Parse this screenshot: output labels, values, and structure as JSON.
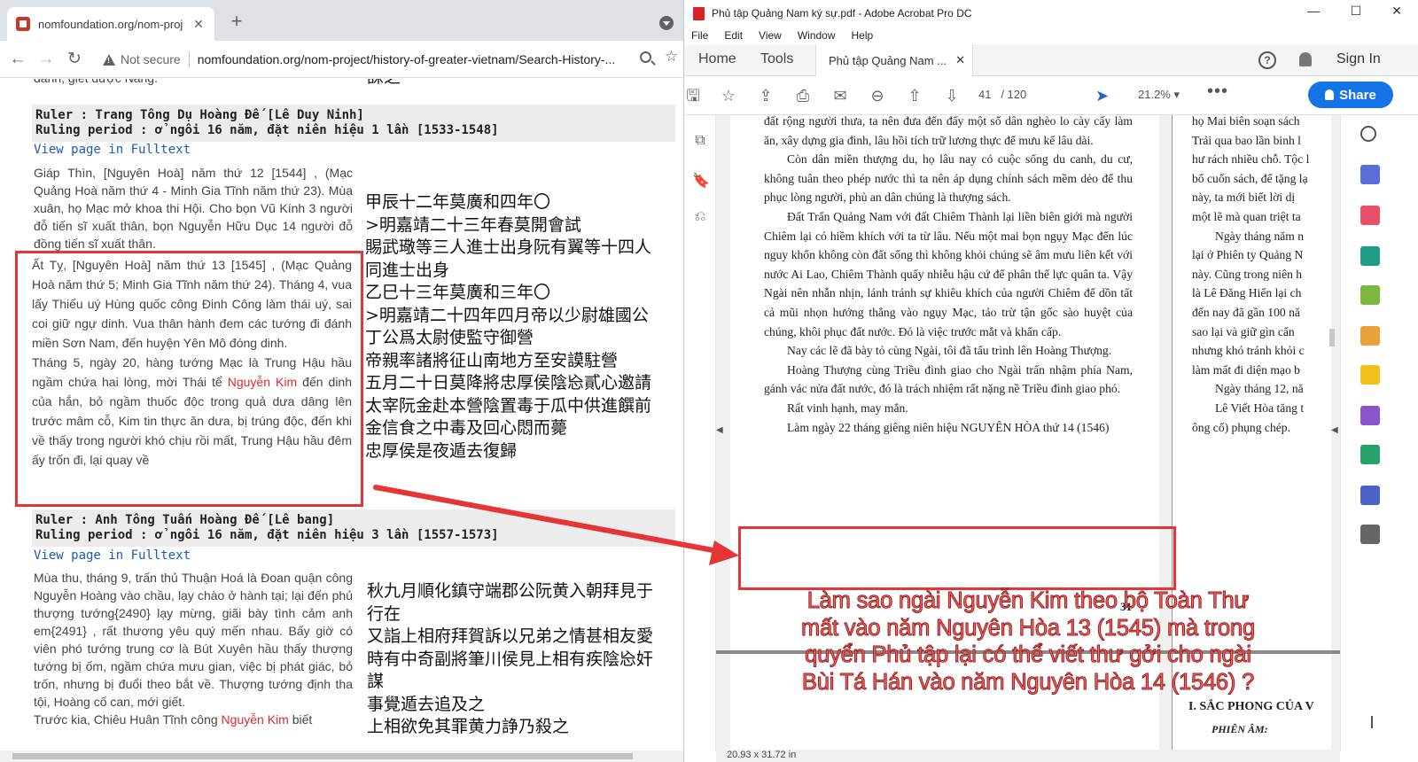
{
  "browser": {
    "tab_title": "nomfoundation.org/nom-projec",
    "not_secure": "Not secure",
    "url": "nomfoundation.org/nom-project/history-of-greater-vietnam/Search-History-...",
    "content": {
      "top_vn_fragment": "danh, giết được Năng.",
      "top_cn_fragment": "誅之",
      "rulers": [
        {
          "ruler_line": "Ruler : Trang Tông Dụ Hoàng Đế  [Lê Duy Ninh]",
          "period_line": "Ruling period : ở ngôi 16 năm, đặt niên hiệu 1 lần [1533-1548]",
          "fulltext": "View page in Fulltext"
        },
        {
          "ruler_line": "Ruler : Anh Tông Tuấn Hoàng Đế  [Lê bang]",
          "period_line": "Ruling period : ở ngôi 16 năm, đặt niên hiệu 3 lần [1557-1573]",
          "fulltext": "View page in Fulltext"
        }
      ],
      "entry1_vn": "Giáp Thìn, [Nguyên Hoà] năm thứ 12 [1544] , (Mạc Quảng Hoà năm thứ 4 - Minh Gia Tĩnh năm thứ 23). Mùa xuân, họ Mạc mở khoa thi Hội. Cho bọn Vũ Kính 3 người đỗ tiến sĩ xuất thân, bọn Nguyễn Hữu Dục 14 người đỗ đồng tiến sĩ xuất thân.",
      "entry2_vn_a": "Ất Tỵ, [Nguyên Hoà] năm thứ 13 [1545] , (Mạc Quảng Hoà năm thứ 5; Minh Gia Tĩnh năm thứ 24). Tháng 4, vua lấy Thiếu uý Hùng quốc công Đinh Công làm thái uý, sai coi giữ ngự dinh. Vua thân hành đem các tướng đi đánh miền Sơn Nam, đến huyện Yên Mô đóng dinh.",
      "entry2_vn_b1": "Tháng 5, ngày 20, hàng tướng Mạc là Trung Hậu hầu ngầm chứa hai lòng, mời Thái tể ",
      "entry2_vn_name": "Nguyễn Kim",
      "entry2_vn_b2": " đến dinh của hắn, bỏ ngầm thuốc độc trong quả dưa dâng lên trước mâm cỗ, Kim tin thực ăn dưa, bị trúng độc, đến khi về thấy trong người khó chịu rồi mất, Trung Hậu hầu đêm ấy trốn đi, lại quay về",
      "entry1_cn": [
        "甲辰十二年莫廣和四年〇",
        ">明嘉靖二十三年春莫開會試",
        "賜武璥等三人進士出身阮有翼等十四人",
        "同進士出身",
        "乙巳十三年莫廣和三年〇",
        ">明嘉靖二十四年四月帝以少尉雄國公",
        "丁公爲太尉使監守御營",
        "帝親率諸將征山南地方至安謨駐營",
        "五月二十日莫降將忠厚侯陰㤀貳心邀請",
        "太宰阮金赴本營陰置毒于瓜中供進饌前",
        "金信食之中毒及回心悶而薨",
        "忠厚侯是夜遁去復歸"
      ],
      "entry3_vn_a": "Mùa thu, tháng 9, trấn thủ Thuận Hoá là Đoan quận công Nguyễn Hoàng vào chầu, lạy chào ở hành tại; lại đến phủ thượng tướng{2490} lạy mừng, giãi bày tình cảm anh em{2491} , rất thương yêu quý mến nhau. Bấy giờ có viên phó tướng trung cơ là Bút Xuyên hầu thấy thượng tướng bị ốm, ngầm chứa mưu gian, việc bị phát giác, bỏ trốn, nhưng bị đuổi theo bắt về. Thượng tướng định tha tội, Hoàng cố can, mới giết.",
      "entry3_vn_b1": "Trước kia, Chiêu Huân Tĩnh công ",
      "entry3_vn_name": "Nguyễn Kim",
      "entry3_vn_b2": " biết",
      "entry3_cn": [
        "秋九月順化鎮守端郡公阮黄入朝拜見于",
        "行在",
        "又詣上相府拜賀訴以兄弟之情甚相友愛",
        "時有中奇副將筆川侯見上相有疾陰㤀奸",
        "謀",
        "事覺遁去追及之",
        "上相欲免其罪黄力諍乃殺之"
      ]
    }
  },
  "acrobat": {
    "window_title": "Phủ tập Quảng Nam ký sự.pdf - Adobe Acrobat Pro DC",
    "menu": [
      "File",
      "Edit",
      "View",
      "Window",
      "Help"
    ],
    "nav": [
      "Home",
      "Tools"
    ],
    "doc_tab": "Phủ tập Quảng Nam ...",
    "sign_in": "Sign In",
    "page_current": "41",
    "page_total": "/ 120",
    "zoom": "21.2%",
    "share": "Share",
    "page_size": "20.93 x 31.72 in",
    "page1_paragraphs": [
      "đất rộng người thưa, ta nên đưa đến đấy một số dân nghèo lo cày cấy làm ăn, xây dựng gia đình, lâu hồi tích trữ lương thực để mưu kế lâu dài.",
      "Còn dân miền thượng du, họ lâu nay có cuộc sống du canh, du cư, không tuân theo phép nước thì ta nên áp dụng chính sách mềm dẻo để thu phục lòng người, phủ an dân chúng là thượng sách.",
      "Đất Trấn Quảng Nam với đất Chiêm Thành lại liền biên giới mà người Chiêm lại có hiềm khích với ta từ lâu. Nếu một mai bọn ngụy Mạc đến lúc nguy khốn không còn đất sống thì không khỏi chúng sẽ âm mưu liên kết với nước Ai Lao, Chiêm Thành quấy nhiễu hậu cứ để phân thế lực quân ta. Vậy Ngài nên nhẫn nhịn, lánh tránh sự khiêu khích của người Chiêm để dồn tất cả mũi nhọn hướng thẳng vào ngụy Mạc, tảo trừ tận gốc sào huyệt của chúng, khôi phục đất nước. Đó là việc trước mắt và khẩn cấp.",
      "Nay các lẽ đã bày tỏ cùng Ngài, tôi đã tấu trình lên Hoàng Thượng.",
      "Hoàng Thượng cùng Triều đình giao cho Ngài trấn nhậm phía Nam, gánh vác nửa đất nước, đó là trách nhiệm rất nặng nề Triều đình giao phó.",
      "Rất vinh hạnh, may mắn.",
      "Làm ngày 22 tháng giêng niên hiệu NGUYÊN HÒA thứ 14 (1546)"
    ],
    "page_number_mark": "31",
    "page2_lines": [
      "họ Mai biên soạn sách",
      "Trải qua bao lần binh l",
      "hư rách nhiều chỗ. Tộc l",
      "bổ cuốn sách, để tặng lạ",
      "này, ta mới biết lời dị",
      "một lẽ mà quan triệt ta",
      "Ngày tháng năm n",
      "lại ở Phiên ty Quảng N",
      "này. Cũng trong niên h",
      "là Lê Đăng Hiển lại ch",
      "đến nay đã gần 100 nă",
      "sao lại và giữ gìn cẩn",
      "nhưng khó tránh khỏi c",
      "làm mất đi diện mạo b",
      "Ngày tháng 12, nă",
      "Lê Viết Hòa tăng t",
      "ông cố) phụng chép."
    ],
    "sac_phong": "I. SẮC PHONG CỦA V",
    "phien_am": "PHIÊN ÂM:"
  },
  "annotation": {
    "question": "Làm sao ngài Nguyễn Kim theo bộ Toàn Thư mất vào năm Nguyên Hòa 13 (1545) mà trong quyển Phủ tập lại có thể viết thư gởi cho ngài Bùi Tá Hán vào năm Nguyên Hòa 14 (1546) ?",
    "color": "#e53535"
  }
}
